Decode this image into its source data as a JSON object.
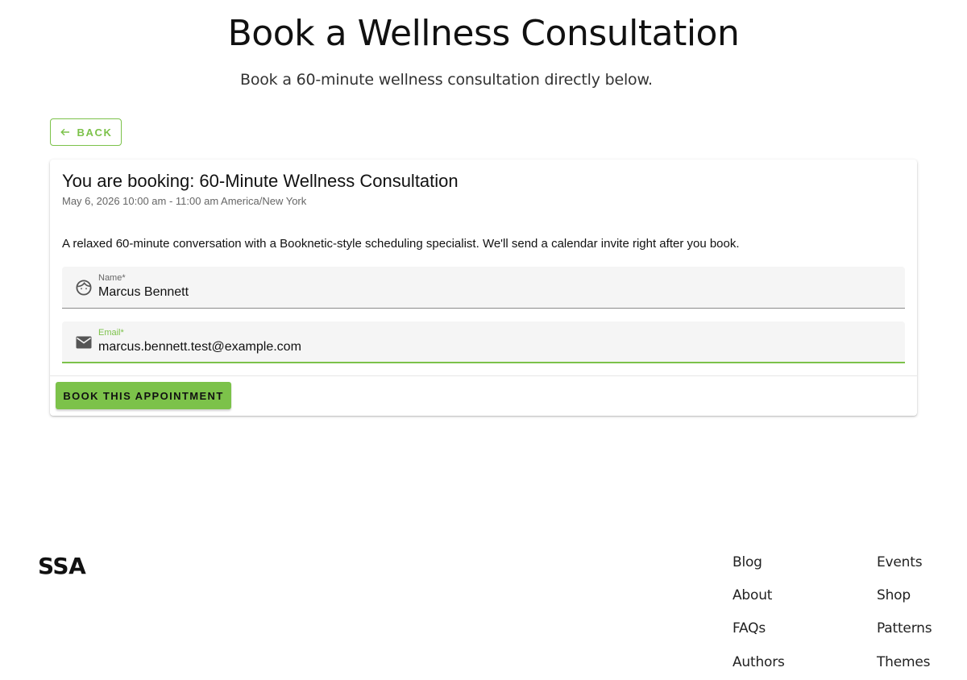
{
  "header": {
    "title": "Book a Wellness Consultation",
    "subtitle": "Book a 60-minute wellness consultation directly below."
  },
  "back_button": {
    "label": "BACK",
    "icon": "arrow-left-icon"
  },
  "booking": {
    "heading": "You are booking: 60-Minute Wellness Consultation",
    "datetime": "May 6, 2026 10:00 am - 11:00 am America/New York",
    "description": "A relaxed 60-minute conversation with a Booknetic-style scheduling specialist. We'll send a calendar invite right after you book.",
    "fields": {
      "name": {
        "label": "Name*",
        "value": "Marcus Bennett",
        "icon": "face-icon"
      },
      "email": {
        "label": "Email*",
        "value": "marcus.bennett.test@example.com",
        "icon": "mail-icon"
      }
    },
    "submit_label": "BOOK THIS APPOINTMENT"
  },
  "footer": {
    "logo": "SSA",
    "links_col1": [
      "Blog",
      "About",
      "FAQs",
      "Authors"
    ],
    "links_col2": [
      "Events",
      "Shop",
      "Patterns",
      "Themes"
    ]
  },
  "colors": {
    "accent": "#7cc24a",
    "text": "#111111",
    "muted": "#666666",
    "field_bg": "#f5f5f5"
  }
}
